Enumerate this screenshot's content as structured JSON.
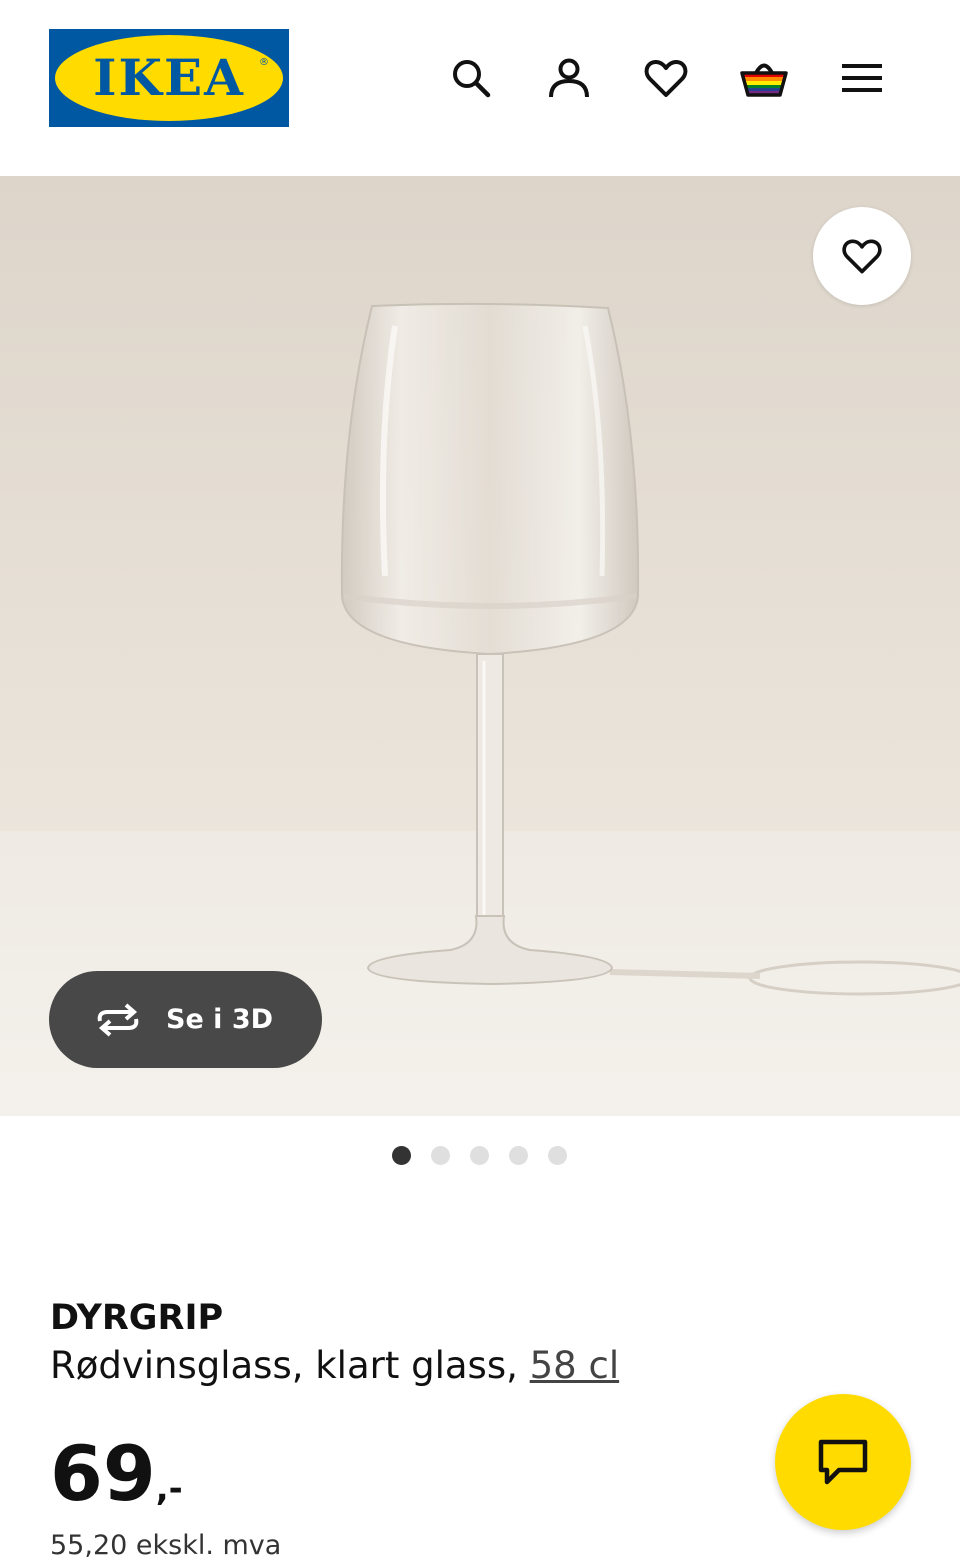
{
  "header": {
    "logo_text": "IKEA",
    "icons": [
      "search-icon",
      "account-icon",
      "heart-icon",
      "basket-icon",
      "menu-icon"
    ]
  },
  "gallery": {
    "view_3d_label": "Se i 3D",
    "slide_count": 5,
    "active_slide": 1
  },
  "product": {
    "name": "DYRGRIP",
    "description": "Rødvinsglass, klart glass, ",
    "volume": "58 cl",
    "price": "69",
    "price_suffix": ",-",
    "price_ex_vat": "55,20 ekskl. mva"
  },
  "colors": {
    "ikea_blue": "#0058a3",
    "ikea_yellow": "#ffdb00",
    "button_dark": "#484848"
  }
}
